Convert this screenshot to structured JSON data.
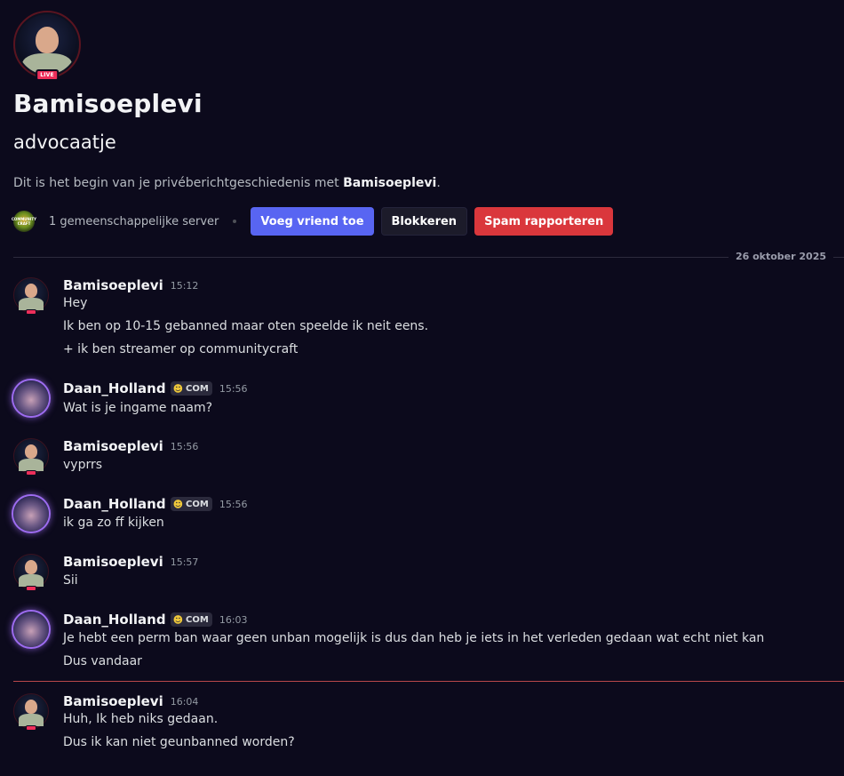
{
  "profile": {
    "display_name": "Bamisoeplevi",
    "username": "advocaatje",
    "live_badge": "LIVE",
    "intro_prefix": "Dit is het begin van je privéberichtgeschiedenis met ",
    "intro_name": "Bamisoeplevi",
    "intro_suffix": "."
  },
  "actions": {
    "server_icon_label": "COMMUNITY CRAFT",
    "mutual_servers": "1 gemeenschappelijke server",
    "add_friend": "Voeg vriend toe",
    "block": "Blokkeren",
    "report_spam": "Spam rapporteren"
  },
  "date_divider": "26 oktober 2025",
  "tag_label": "COM",
  "colors": {
    "background": "#0c0a1c",
    "primary_button": "#5865f2",
    "danger_button": "#da373c",
    "new_message_line": "#b8474a",
    "live": "#ed2f5a"
  },
  "messages": [
    {
      "author": "Bamisoeplevi",
      "time": "15:12",
      "lines": [
        "Hey",
        "Ik ben op 10-15 gebanned maar oten speelde ik neit eens.",
        "+ ik ben streamer op communitycraft"
      ]
    },
    {
      "author": "Daan_Holland",
      "tag": "COM",
      "time": "15:56",
      "lines": [
        "Wat is je ingame naam?"
      ]
    },
    {
      "author": "Bamisoeplevi",
      "time": "15:56",
      "lines": [
        "vyprrs"
      ]
    },
    {
      "author": "Daan_Holland",
      "tag": "COM",
      "time": "15:56",
      "lines": [
        "ik ga zo ff kijken"
      ]
    },
    {
      "author": "Bamisoeplevi",
      "time": "15:57",
      "lines": [
        "Sii"
      ]
    },
    {
      "author": "Daan_Holland",
      "tag": "COM",
      "time": "16:03",
      "lines": [
        "Je hebt een perm ban waar geen unban mogelijk is dus dan heb je iets in het verleden gedaan wat echt niet kan",
        "Dus vandaar"
      ]
    },
    {
      "author": "Bamisoeplevi",
      "time": "16:04",
      "lines": [
        "Huh, Ik heb niks gedaan.",
        "Dus ik kan niet geunbanned worden?"
      ]
    }
  ]
}
